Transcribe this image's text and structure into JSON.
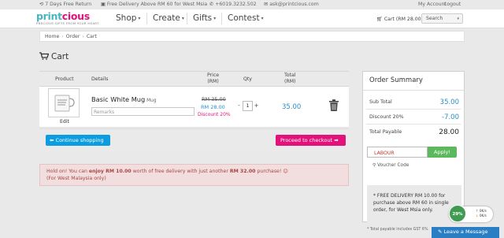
{
  "topbar": {
    "return_text": "7 Days Free Return",
    "delivery_text": "Free Delivery Above RM 60 for West Msia",
    "phone": "+6019.3232.502",
    "email": "ask@printcious.com",
    "account_link": "My Account",
    "logout_link": "Logout"
  },
  "brand": {
    "logo_part1": "print",
    "logo_part2": "cious",
    "tagline": "PRECIOUS GIFTS FROM YOUR HEART"
  },
  "nav": {
    "items": [
      "Shop",
      "Create",
      "Gifts",
      "Contest"
    ],
    "cart_label": "Cart (RM 28.00)",
    "search_label": "Search"
  },
  "breadcrumb": [
    "Home",
    "Order",
    "Cart"
  ],
  "page": {
    "title": "Cart"
  },
  "table": {
    "headers": {
      "product": "Product",
      "details": "Details",
      "price": "Price",
      "price_unit": "(RM)",
      "qty": "Qty",
      "total": "Total",
      "total_unit": "(RM)"
    },
    "rows": [
      {
        "name": "Basic White Mug",
        "type": "Mug",
        "edit_label": "Edit",
        "remarks_placeholder": "Remarks",
        "price_old": "RM 35.00",
        "price_new": "RM 28.00",
        "discount": "Discount 20%",
        "qty": "1",
        "qty_minus": "-",
        "qty_plus": "+",
        "total": "35.00"
      }
    ]
  },
  "actions": {
    "continue_label": "Continue shopping",
    "checkout_label": "Proceed to checkout"
  },
  "alert": {
    "text_pre": "Hold on! You can ",
    "amount_bold": "enjoy RM 10.00",
    "text_mid": " worth of free delivery with just another ",
    "remaining_bold": "RM 32.00",
    "text_post": " purchase! ☺",
    "line2": "(For West Malaysia only)"
  },
  "summary": {
    "title": "Order Summary",
    "subtotal_label": "Sub Total",
    "subtotal_value": "35.00",
    "discount_label": "Discount 20%",
    "discount_value": "-7.00",
    "payable_label": "Total Payable",
    "payable_value": "28.00",
    "coupon_value": "LABOUR",
    "apply_label": "Apply!",
    "voucher_label": "Voucher Code",
    "free_note": "* FREE DELIVERY RM 10.00 for purchase above RM 60 in single order, for West Msia only.",
    "gst_note": "* Total payable includes GST 6%"
  },
  "widgets": {
    "speed_percent": "29%",
    "speed_up": "0K/s",
    "speed_down": "0K/s",
    "leave_message": "Leave a Message"
  },
  "colors": {
    "accent_blue": "#0c9de0",
    "accent_pink": "#e2127a",
    "logo_teal": "#45b5c4",
    "apply_green": "#5cb85c",
    "alert_bg": "#f2dede"
  }
}
